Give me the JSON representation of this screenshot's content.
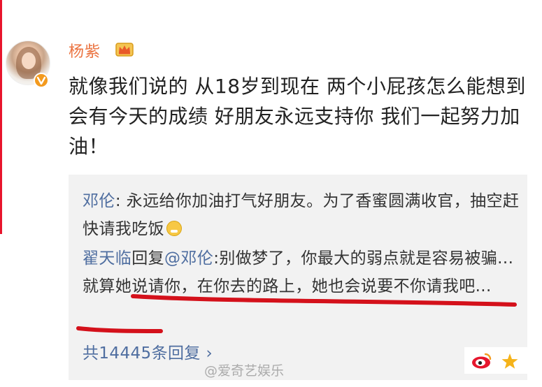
{
  "post": {
    "username": "杨紫",
    "text": "就像我们说的 从18岁到现在 两个小屁孩怎么能想到会有今天的成绩 好朋友永远支持你 我们一起努力加油！"
  },
  "comments": [
    {
      "author": "邓伦",
      "text": ": 永远给你加油打气好朋友。为了香蜜圆满收官，抽空赶快请我吃饭"
    },
    {
      "author": "翟天临",
      "reply_label": "回复",
      "mention": "@邓伦",
      "text": ":别做梦了，你最大的弱点就是容易被骗...就算她说请你，在你去的路上，她也会说要不你请我吧..."
    }
  ],
  "more_replies": "共14445条回复 ›",
  "watermark": "@爱奇艺娱乐",
  "colors": {
    "username": "#eb7340",
    "link": "#4f6ea0",
    "underline": "#d4111b",
    "left_bar": "#e8142c"
  },
  "icons": [
    "avatar",
    "vip-badge-icon",
    "crown-icon",
    "grin-emoji-icon",
    "weibo-logo-icon",
    "star-icon"
  ]
}
